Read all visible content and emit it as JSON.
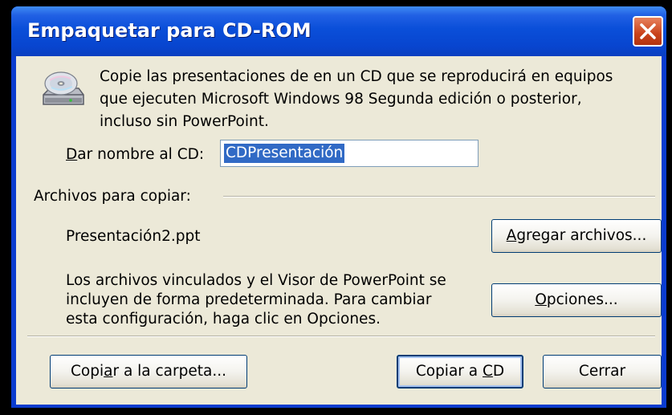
{
  "window": {
    "title": "Empaquetar para CD-ROM"
  },
  "description": {
    "line1": "Copie las presentaciones de en un CD que se reproducirá en equipos",
    "line2": "que ejecuten Microsoft Windows 98 Segunda edición o posterior,",
    "line3": "incluso sin PowerPoint."
  },
  "cd_name": {
    "label_accel": "D",
    "label_rest": "ar nombre al CD:",
    "value": "CDPresentación"
  },
  "files": {
    "group_label": "Archivos para copiar:",
    "items": [
      "Presentación2.ppt"
    ]
  },
  "linked_info": {
    "line1": "Los archivos vinculados y el Visor de PowerPoint se",
    "line2": "incluyen de forma predeterminada. Para cambiar",
    "line3": "esta configuración, haga clic en Opciones."
  },
  "buttons": {
    "add_files": {
      "accel": "A",
      "rest": "gregar archivos..."
    },
    "options": {
      "accel": "O",
      "rest": "pciones..."
    },
    "copy_folder": {
      "pre": "Copi",
      "accel": "a",
      "rest": "r a la carpeta..."
    },
    "copy_cd": {
      "pre": "Copiar a ",
      "accel": "C",
      "rest": "D"
    },
    "close": {
      "label": "Cerrar"
    }
  },
  "colors": {
    "titlebar": "#0a4fd9",
    "dialog_bg": "#ece9d8",
    "selection": "#316ac5",
    "close_button": "#c9421a"
  },
  "icons": {
    "cd_drive": "cd-drive-icon",
    "close": "close-icon"
  }
}
